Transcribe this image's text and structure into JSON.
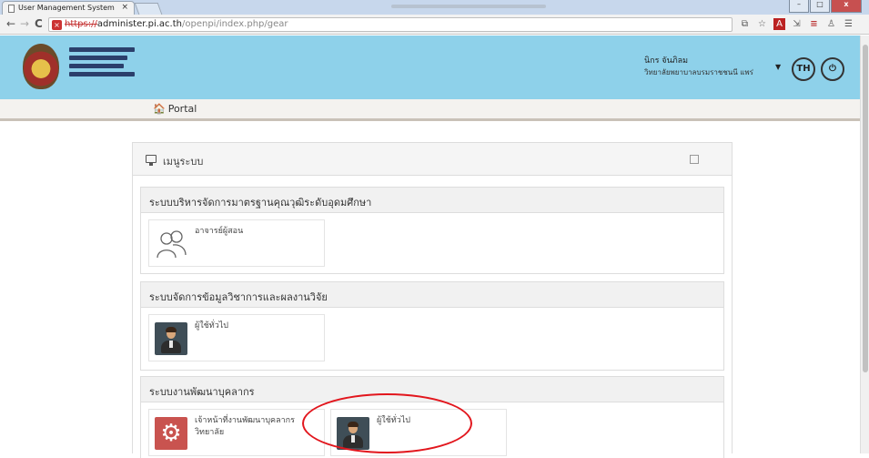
{
  "browser": {
    "tab_title": "User Management System",
    "tab_close": "×",
    "url_scheme": "https://",
    "url_host": "administer.pi.ac.th",
    "url_path": "/openpi/index.php/gear",
    "nav_back": "←",
    "nav_forward": "→",
    "nav_reload": "C",
    "window_buttons": [
      "–",
      "□",
      "x"
    ],
    "tool_icons": [
      "extensions-icon",
      "star-icon",
      "pdf-icon",
      "tool-icon",
      "abbyy-icon",
      "account-icon",
      "menu-icon"
    ]
  },
  "header": {
    "background": "#8ed1ea",
    "user_name": "นิกร จันภิลม",
    "user_college": "วิทยาลัยพยาบาลบรมราชชนนี แพร่",
    "lang_button": "TH",
    "power_icon": "⏻"
  },
  "breadcrumb": {
    "home_icon": "🏠",
    "label": "Portal"
  },
  "panel": {
    "title": "เมนูระบบ",
    "sections": [
      {
        "title": "ระบบบริหารจัดการมาตรฐานคุณวุฒิระดับอุดมศึกษา",
        "cards": [
          {
            "label": "อาจารย์ผู้สอน",
            "icon": "people-icon"
          }
        ]
      },
      {
        "title": "ระบบจัดการข้อมูลวิชาการและผลงานวิจัย",
        "cards": [
          {
            "label": "ผู้ใช้ทั่วไป",
            "icon": "person-icon"
          }
        ]
      },
      {
        "title": "ระบบงานพัฒนาบุคลากร",
        "cards": [
          {
            "label": "เจ้าหน้าที่งานพัฒนาบุคลากร",
            "label2": "วิทยาลัย",
            "icon": "gear-icon"
          },
          {
            "label": "ผู้ใช้ทั่วไป",
            "icon": "person-icon"
          }
        ]
      }
    ]
  },
  "annotation_color": "#e2161d"
}
